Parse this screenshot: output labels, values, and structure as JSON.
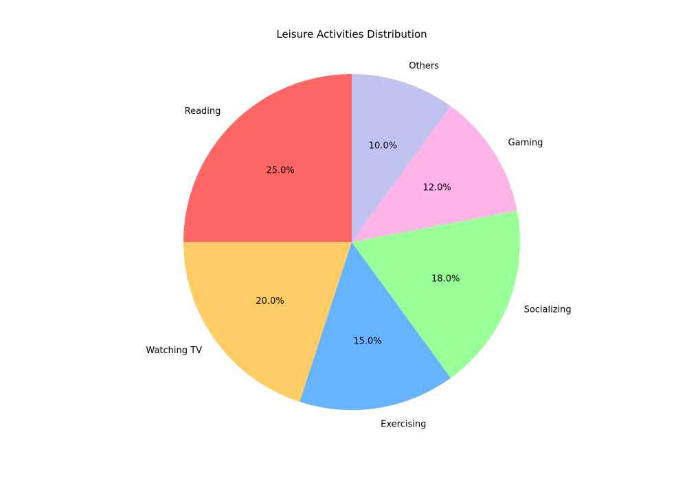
{
  "chart_data": {
    "type": "pie",
    "title": "Leisure Activities Distribution",
    "start_angle_deg": 90,
    "direction": "counterclockwise",
    "value_format": "percent_one_decimal",
    "slices": [
      {
        "label": "Reading",
        "value": 25.0,
        "pct_label": "25.0%",
        "color": "#ff6666"
      },
      {
        "label": "Watching TV",
        "value": 20.0,
        "pct_label": "20.0%",
        "color": "#ffcc66"
      },
      {
        "label": "Exercising",
        "value": 15.0,
        "pct_label": "15.0%",
        "color": "#66b3ff"
      },
      {
        "label": "Socializing",
        "value": 18.0,
        "pct_label": "18.0%",
        "color": "#99ff99"
      },
      {
        "label": "Gaming",
        "value": 12.0,
        "pct_label": "12.0%",
        "color": "#ffb3e6"
      },
      {
        "label": "Others",
        "value": 10.0,
        "pct_label": "10.0%",
        "color": "#c2c2f0"
      }
    ]
  }
}
